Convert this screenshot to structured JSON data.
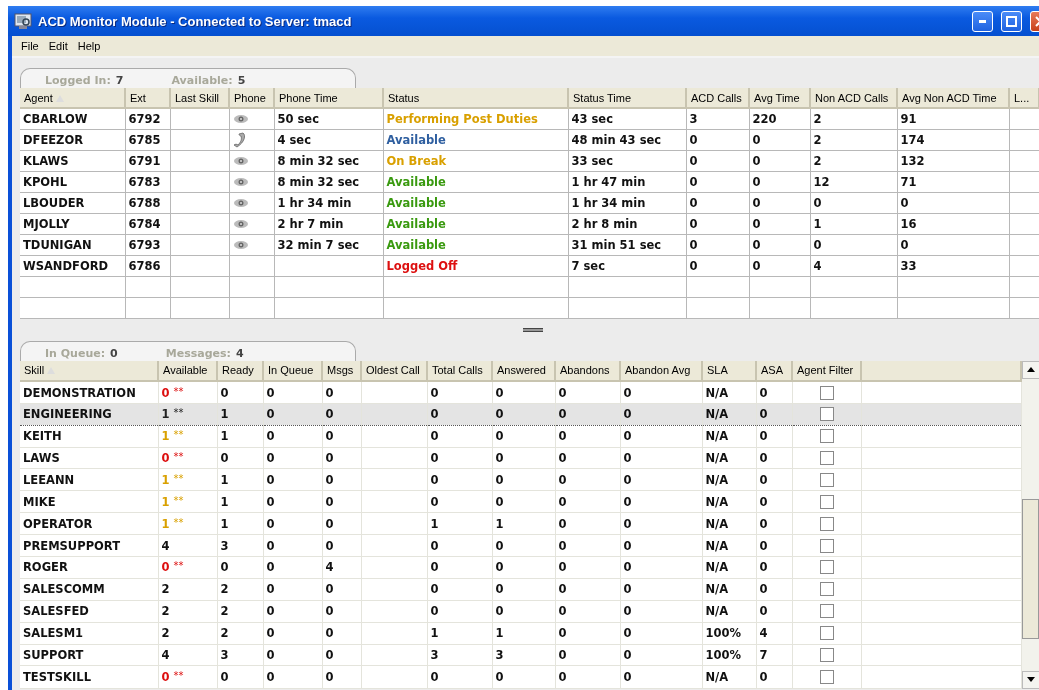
{
  "window": {
    "title": "ACD Monitor Module - Connected to Server: tmacd"
  },
  "menu": [
    "File",
    "Edit",
    "Help"
  ],
  "agents_panel": {
    "summary": [
      {
        "label": "Logged In:",
        "value": "7"
      },
      {
        "label": "Available:",
        "value": "5"
      }
    ],
    "columns": [
      "Agent",
      "Ext",
      "Last Skill",
      "Phone",
      "Phone Time",
      "Status",
      "Status Time",
      "ACD Calls",
      "Avg Time",
      "Non ACD Calls",
      "Avg Non ACD Time",
      "L..."
    ],
    "rows": [
      {
        "agent": "CBARLOW",
        "ext": "6792",
        "phone": {
          "kind": "idle"
        },
        "phone_time": "50 sec",
        "status": "Performing Post Duties",
        "color": "#d9a000",
        "status_time": "43 sec",
        "acd_calls": "3",
        "avg_time": "220",
        "non_acd_calls": "2",
        "avg_non_acd_time": "91"
      },
      {
        "agent": "DFEEZOR",
        "ext": "6785",
        "phone": {
          "kind": "handset"
        },
        "phone_time": "4 sec",
        "status": "Available",
        "color": "#2f5fa0",
        "status_time": "48 min  43 sec",
        "acd_calls": "0",
        "avg_time": "0",
        "non_acd_calls": "2",
        "avg_non_acd_time": "174"
      },
      {
        "agent": "KLAWS",
        "ext": "6791",
        "phone": {
          "kind": "idle"
        },
        "phone_time": "8 min  32 sec",
        "status": "On Break",
        "color": "#d9a000",
        "status_time": "33 sec",
        "acd_calls": "0",
        "avg_time": "0",
        "non_acd_calls": "2",
        "avg_non_acd_time": "132"
      },
      {
        "agent": "KPOHL",
        "ext": "6783",
        "phone": {
          "kind": "idle"
        },
        "phone_time": "8 min  32 sec",
        "status": "Available",
        "color": "#3a9a10",
        "status_time": "1 hr  47 min",
        "acd_calls": "0",
        "avg_time": "0",
        "non_acd_calls": "12",
        "avg_non_acd_time": "71"
      },
      {
        "agent": "LBOUDER",
        "ext": "6788",
        "phone": {
          "kind": "idle"
        },
        "phone_time": "1 hr  34 min",
        "status": "Available",
        "color": "#3a9a10",
        "status_time": "1 hr  34 min",
        "acd_calls": "0",
        "avg_time": "0",
        "non_acd_calls": "0",
        "avg_non_acd_time": "0"
      },
      {
        "agent": "MJOLLY",
        "ext": "6784",
        "phone": {
          "kind": "idle"
        },
        "phone_time": "2 hr  7 min",
        "status": "Available",
        "color": "#3a9a10",
        "status_time": "2 hr  8 min",
        "acd_calls": "0",
        "avg_time": "0",
        "non_acd_calls": "1",
        "avg_non_acd_time": "16"
      },
      {
        "agent": "TDUNIGAN",
        "ext": "6793",
        "phone": {
          "kind": "idle"
        },
        "phone_time": "32 min  7 sec",
        "status": "Available",
        "color": "#3a9a10",
        "status_time": "31 min  51 sec",
        "acd_calls": "0",
        "avg_time": "0",
        "non_acd_calls": "0",
        "avg_non_acd_time": "0"
      },
      {
        "agent": "WSANDFORD",
        "ext": "6786",
        "status": "Logged Off",
        "color": "#dd1010",
        "status_time": "7 sec",
        "acd_calls": "0",
        "avg_time": "0",
        "non_acd_calls": "4",
        "avg_non_acd_time": "33"
      }
    ]
  },
  "skills_panel": {
    "summary": [
      {
        "label": "In Queue:",
        "value": "0"
      },
      {
        "label": "Messages:",
        "value": "4"
      }
    ],
    "columns": [
      "Skill",
      "Available",
      "Ready",
      "In Queue",
      "Msgs",
      "Oldest Call",
      "Total Calls",
      "Answered",
      "Abandons",
      "Abandon Avg",
      "SLA",
      "ASA",
      "Agent Filter"
    ],
    "rows": [
      {
        "skill": "DEMONSTRATION",
        "available": "0",
        "flag": "**",
        "color": "#dd1010",
        "selected": false,
        "ready": "0",
        "in_queue": "0",
        "msgs": "0",
        "total_calls": "0",
        "answered": "0",
        "abandons": "0",
        "abandon_avg": "0",
        "sla": "N/A",
        "asa": "0",
        "agent_filter": false
      },
      {
        "skill": "ENGINEERING",
        "available": "1",
        "flag": "**",
        "color": "#222222",
        "selected": true,
        "ready": "1",
        "in_queue": "0",
        "msgs": "0",
        "total_calls": "0",
        "answered": "0",
        "abandons": "0",
        "abandon_avg": "0",
        "sla": "N/A",
        "asa": "0",
        "agent_filter": false
      },
      {
        "skill": "KEITH",
        "available": "1",
        "flag": "**",
        "color": "#d9a000",
        "selected": false,
        "ready": "1",
        "in_queue": "0",
        "msgs": "0",
        "total_calls": "0",
        "answered": "0",
        "abandons": "0",
        "abandon_avg": "0",
        "sla": "N/A",
        "asa": "0",
        "agent_filter": false
      },
      {
        "skill": "LAWS",
        "available": "0",
        "flag": "**",
        "color": "#dd1010",
        "selected": false,
        "ready": "0",
        "in_queue": "0",
        "msgs": "0",
        "total_calls": "0",
        "answered": "0",
        "abandons": "0",
        "abandon_avg": "0",
        "sla": "N/A",
        "asa": "0",
        "agent_filter": false
      },
      {
        "skill": "LEEANN",
        "available": "1",
        "flag": "**",
        "color": "#d9a000",
        "selected": false,
        "ready": "1",
        "in_queue": "0",
        "msgs": "0",
        "total_calls": "0",
        "answered": "0",
        "abandons": "0",
        "abandon_avg": "0",
        "sla": "N/A",
        "asa": "0",
        "agent_filter": false
      },
      {
        "skill": "MIKE",
        "available": "1",
        "flag": "**",
        "color": "#d9a000",
        "selected": false,
        "ready": "1",
        "in_queue": "0",
        "msgs": "0",
        "total_calls": "0",
        "answered": "0",
        "abandons": "0",
        "abandon_avg": "0",
        "sla": "N/A",
        "asa": "0",
        "agent_filter": false
      },
      {
        "skill": "OPERATOR",
        "available": "1",
        "flag": "**",
        "color": "#d9a000",
        "selected": false,
        "ready": "1",
        "in_queue": "0",
        "msgs": "0",
        "total_calls": "1",
        "answered": "1",
        "abandons": "0",
        "abandon_avg": "0",
        "sla": "N/A",
        "asa": "0",
        "agent_filter": false
      },
      {
        "skill": "PREMSUPPORT",
        "available": "4",
        "selected": false,
        "ready": "3",
        "in_queue": "0",
        "msgs": "0",
        "total_calls": "0",
        "answered": "0",
        "abandons": "0",
        "abandon_avg": "0",
        "sla": "N/A",
        "asa": "0",
        "agent_filter": false
      },
      {
        "skill": "ROGER",
        "available": "0",
        "flag": "**",
        "color": "#dd1010",
        "selected": false,
        "ready": "0",
        "in_queue": "0",
        "msgs": "4",
        "total_calls": "0",
        "answered": "0",
        "abandons": "0",
        "abandon_avg": "0",
        "sla": "N/A",
        "asa": "0",
        "agent_filter": false
      },
      {
        "skill": "SALESCOMM",
        "available": "2",
        "selected": false,
        "ready": "2",
        "in_queue": "0",
        "msgs": "0",
        "total_calls": "0",
        "answered": "0",
        "abandons": "0",
        "abandon_avg": "0",
        "sla": "N/A",
        "asa": "0",
        "agent_filter": false
      },
      {
        "skill": "SALESFED",
        "available": "2",
        "selected": false,
        "ready": "2",
        "in_queue": "0",
        "msgs": "0",
        "total_calls": "0",
        "answered": "0",
        "abandons": "0",
        "abandon_avg": "0",
        "sla": "N/A",
        "asa": "0",
        "agent_filter": false
      },
      {
        "skill": "SALESM1",
        "available": "2",
        "selected": false,
        "ready": "2",
        "in_queue": "0",
        "msgs": "0",
        "total_calls": "1",
        "answered": "1",
        "abandons": "0",
        "abandon_avg": "0",
        "sla": "100%",
        "asa": "4",
        "agent_filter": false
      },
      {
        "skill": "SUPPORT",
        "available": "4",
        "selected": false,
        "ready": "3",
        "in_queue": "0",
        "msgs": "0",
        "total_calls": "3",
        "answered": "3",
        "abandons": "0",
        "abandon_avg": "0",
        "sla": "100%",
        "asa": "7",
        "agent_filter": false
      },
      {
        "skill": "TESTSKILL",
        "available": "0",
        "flag": "**",
        "color": "#dd1010",
        "selected": false,
        "ready": "0",
        "in_queue": "0",
        "msgs": "0",
        "total_calls": "0",
        "answered": "0",
        "abandons": "0",
        "abandon_avg": "0",
        "sla": "N/A",
        "asa": "0",
        "agent_filter": false
      }
    ]
  }
}
